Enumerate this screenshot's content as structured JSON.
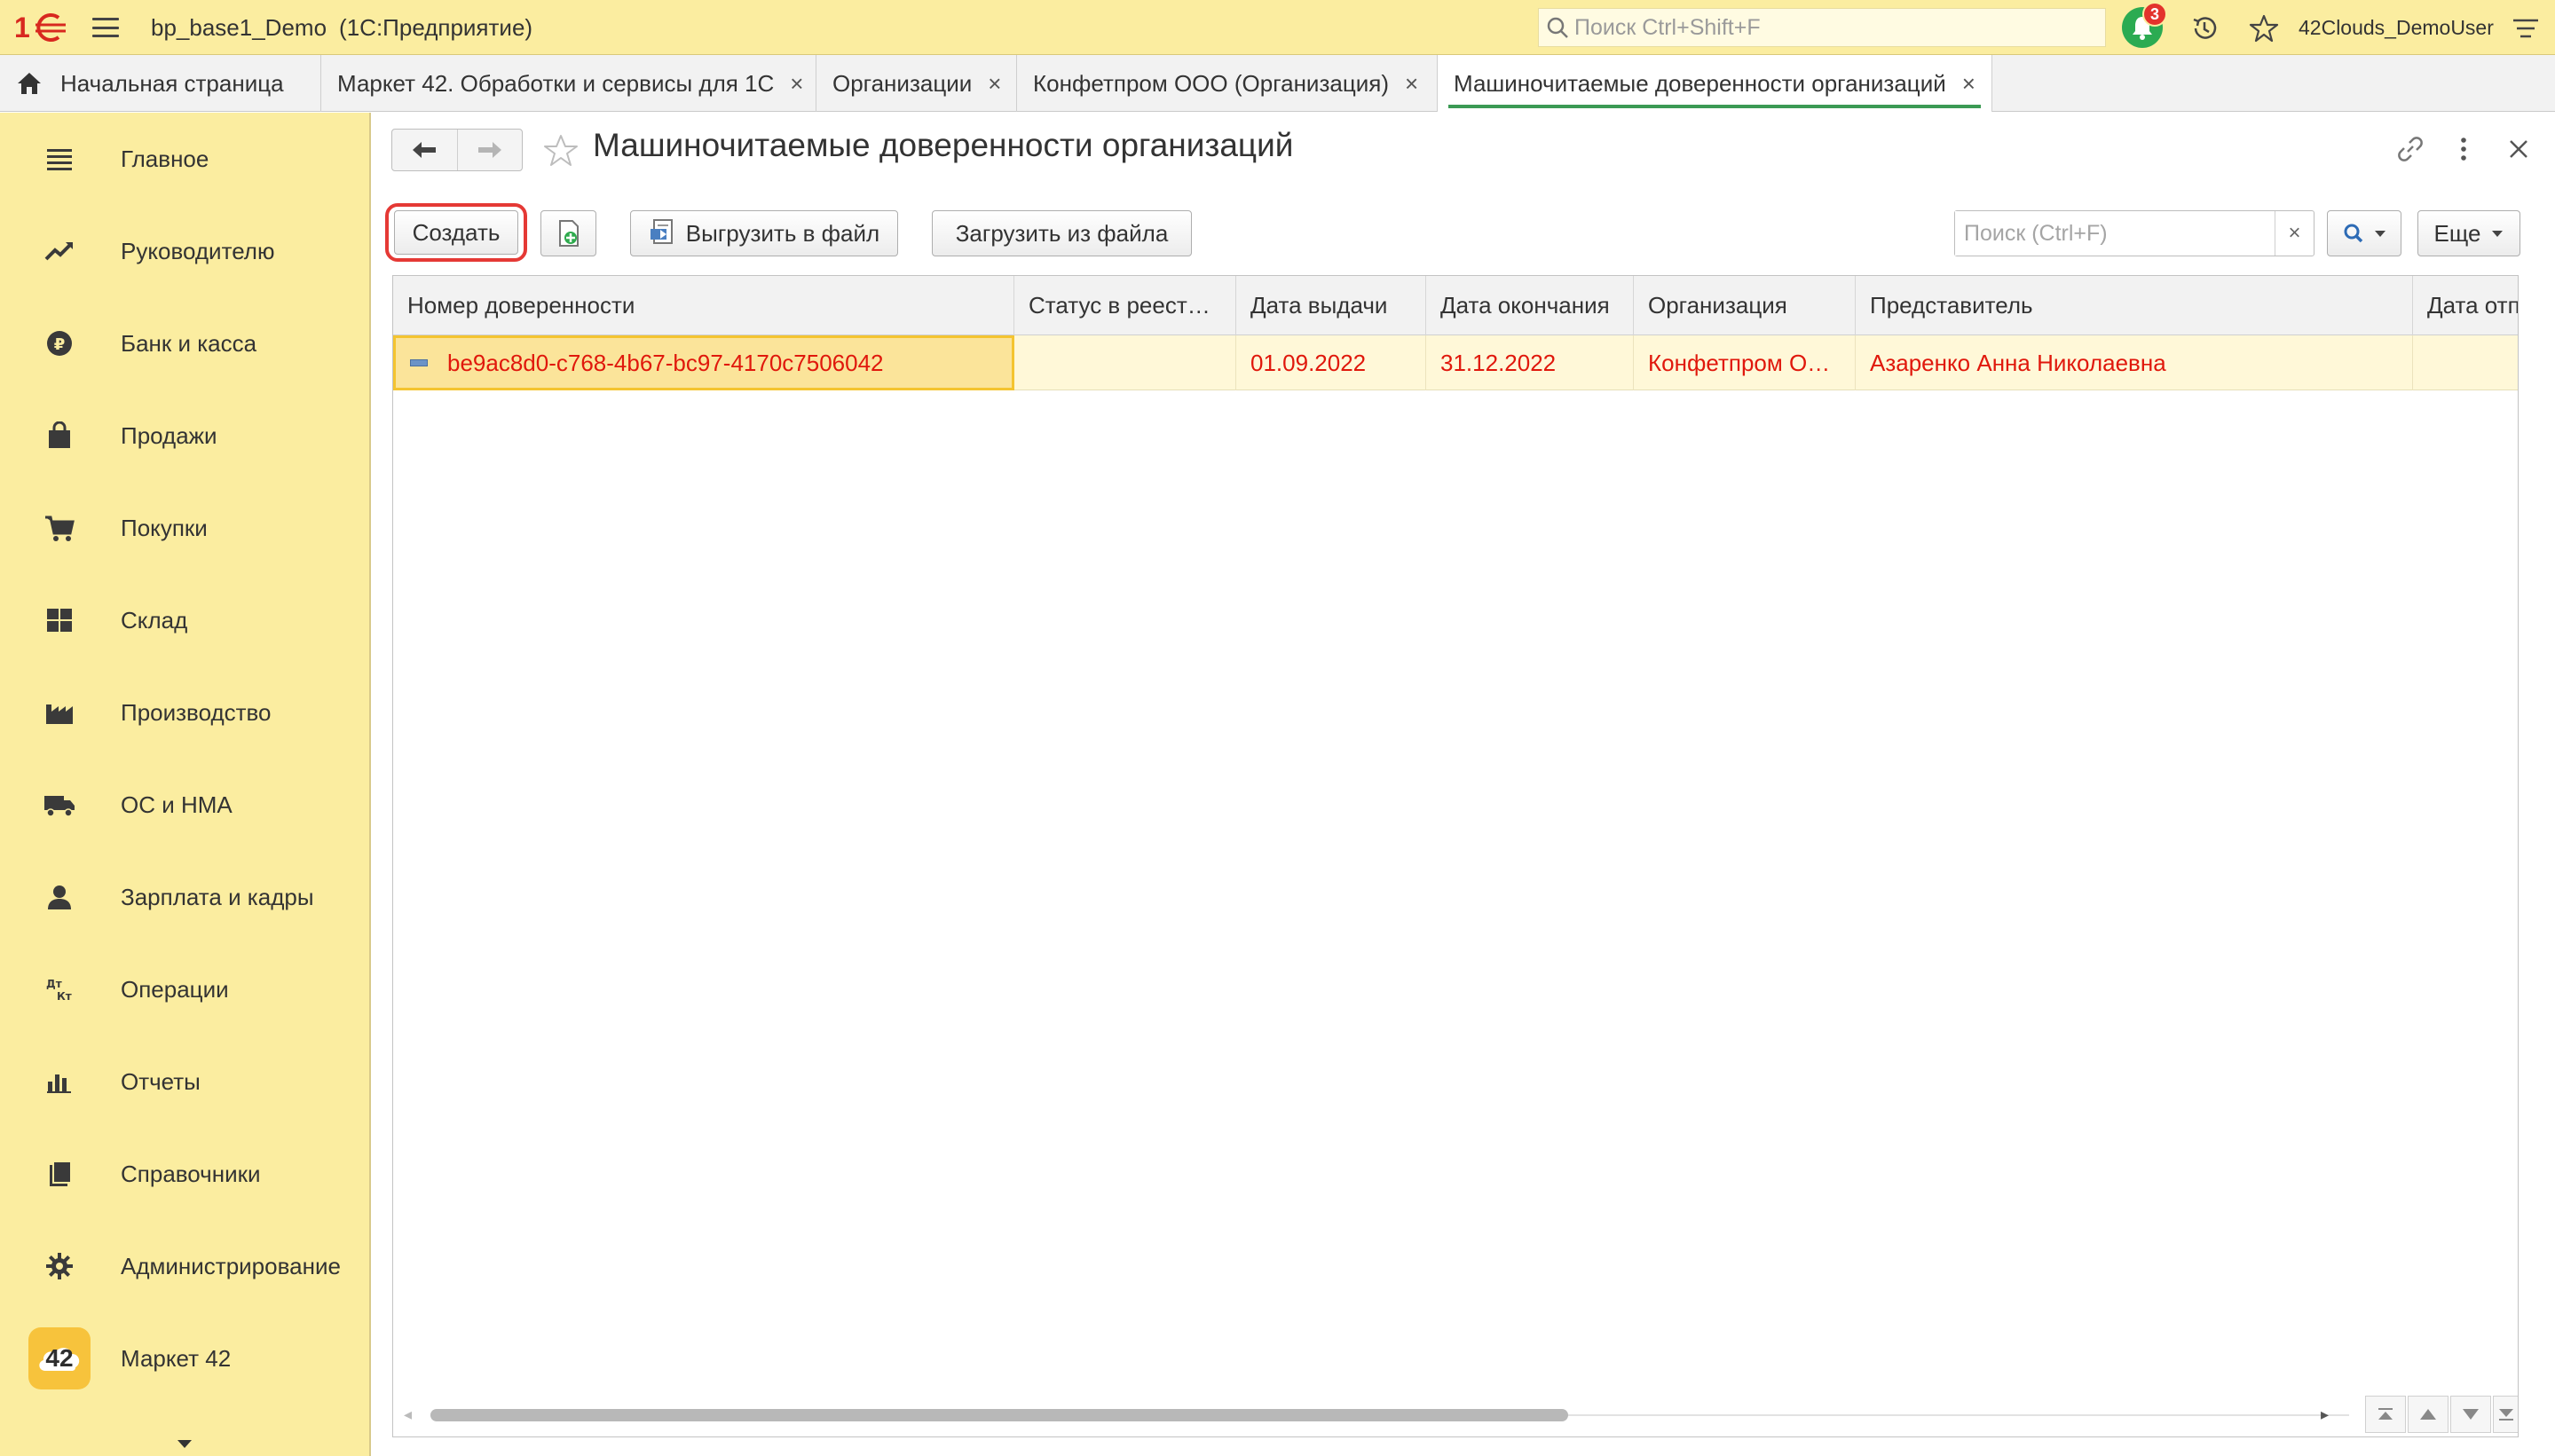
{
  "app": {
    "title": "bp_base1_Demo",
    "subtitle": "(1С:Предприятие)",
    "search_placeholder": "Поиск Ctrl+Shift+F",
    "notification_count": "3",
    "user": "42Clouds_DemoUser"
  },
  "tabs": [
    {
      "label": "Начальная страница",
      "icon": "home-icon"
    },
    {
      "label": "Маркет 42. Обработки и сервисы для 1С",
      "close": "×"
    },
    {
      "label": "Организации",
      "close": "×"
    },
    {
      "label": "Конфетпром ООО (Организация)",
      "close": "×"
    },
    {
      "label": "Машиночитаемые доверенности организаций",
      "close": "×",
      "active": true
    }
  ],
  "sidebar": {
    "items": [
      {
        "label": "Главное",
        "icon": "menu-list-icon"
      },
      {
        "label": "Руководителю",
        "icon": "trend-chart-icon"
      },
      {
        "label": "Банк и касса",
        "icon": "ruble-coin-icon"
      },
      {
        "label": "Продажи",
        "icon": "shopping-bag-icon"
      },
      {
        "label": "Покупки",
        "icon": "shopping-cart-icon"
      },
      {
        "label": "Склад",
        "icon": "warehouse-grid-icon"
      },
      {
        "label": "Производство",
        "icon": "factory-icon"
      },
      {
        "label": "ОС и НМА",
        "icon": "truck-icon"
      },
      {
        "label": "Зарплата и кадры",
        "icon": "person-icon"
      },
      {
        "label": "Операции",
        "icon": "debit-credit-icon"
      },
      {
        "label": "Отчеты",
        "icon": "bar-chart-icon"
      },
      {
        "label": "Справочники",
        "icon": "books-icon"
      },
      {
        "label": "Администрирование",
        "icon": "gear-icon"
      },
      {
        "label": "Маркет 42",
        "icon": "market-cloud-icon",
        "badge": "42"
      }
    ]
  },
  "page": {
    "title": "Машиночитаемые доверенности организаций"
  },
  "toolbar": {
    "create_label": "Создать",
    "export_label": "Выгрузить в файл",
    "import_label": "Загрузить из файла",
    "search_placeholder": "Поиск (Ctrl+F)",
    "clear_label": "×",
    "more_label": "Еще"
  },
  "table": {
    "columns": [
      "Номер доверенности",
      "Статус в реест…",
      "Дата выдачи",
      "Дата окончания",
      "Организация",
      "Представитель",
      "Дата отп"
    ],
    "rows": [
      {
        "number": "be9ac8d0-c768-4b67-bc97-4170c7506042",
        "status": "",
        "issued": "01.09.2022",
        "expires": "31.12.2022",
        "organization": "Конфетпром О…",
        "representative": "Азаренко Анна Николаевна",
        "revoked": ""
      }
    ]
  },
  "colors": {
    "accent_bar": "#fbeda0",
    "highlight_red": "#e53935",
    "row_text": "#e0180c",
    "active_tab_underline": "#3b9a54",
    "bell_green": "#2bab52"
  }
}
